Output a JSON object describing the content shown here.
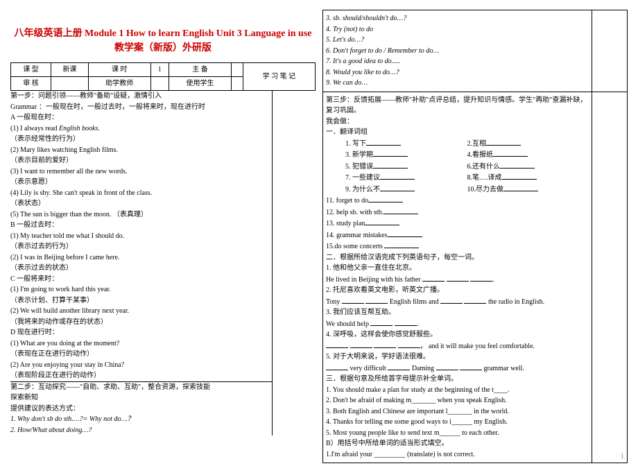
{
  "title": "八年级英语上册 Module 1 How to learn English Unit 3 Language in use 教学案（新版）外研版",
  "hdr": {
    "r1c1": "课  型",
    "r1c2": "新课",
    "r1c3": "课  时",
    "r1c4": "1",
    "r1c5": "主  备",
    "r2c1": "审  核",
    "r2c3": "助学教师",
    "r2c5": "使用学生",
    "notes": "学 习 笔 记"
  },
  "s1": "第一步：问题引领——教师\"备助\"设疑，激情引入",
  "s1a": "Grammar ：一般现在时，一般过去时，一般将来时，现在进行时",
  "s1b": "A 一般现在时：",
  "g1": "(1) I always read English books.",
  "g1t": "（表示经常性的行为）",
  "g2": "(2) Mary likes watching English films.",
  "g2t": "（表示目前的爱好）",
  "g3": "(3) I want to remember all the new words.",
  "g3t": "（表示意愿）",
  "g4": "(4) Lily is shy. She can't speak in front of  the class.",
  "g4t": "（表状态）",
  "g5": "(5) The sun is bigger than the moon.  （表真理）",
  "s1c": "B 一般过去时：",
  "p1": "(1) My teacher told me what I should do.",
  "p1t": "（表示过去的行为）",
  "p2": "(2) I was in Beijing before I came here.",
  "p2t": "（表示过去的状态）",
  "s1d": "C 一般将来时：",
  "f1": "(1) I'm going to work hard this year.",
  "f1t": "（表示计划、打算干某事）",
  "f2": "(2) We will build another library next  year.",
  "f2t": "（我将来的动作或存在的状态）",
  "s1e": "D 现在进行时：",
  "d1": "(1) What are you doing at the moment?",
  "d1t": "（表现在正在进行的动作）",
  "d2": "(2) Are you enjoying your stay in China?",
  "d2t": "（表现阶段正在进行的动作）",
  "s2": "第二步：互动探究——\"自助、求助、互助\"，整合资源，探索技能",
  "s2a": "探索新知",
  "s2b": "提供建议的表达方式：",
  "ex1": "1.  Why don't  sb do sth.…?= Why not do…？",
  "ex2": "2.  How/What about doing…?",
  "ex3": "3.  sb. should/shouldn't do…?",
  "ex4": "4.  Try (not) to do",
  "ex5": "5.  Let's do…?",
  "ex6": "6.  Don't forget to do / Remember to do…",
  "ex7": "7.  It's a good idea to do.....",
  "ex8": "8.  Would you like to do…?",
  "ex9": "9.  We can do…",
  "s3": "第三步：反馈拓展——教师\"补助\"点评总结，提升知识与情感。学生\"再助\"查漏补缺，复习巩固。",
  "s3a": "我会做：",
  "s3b": "一．翻译词组",
  "t1": "1. 写下",
  "t2": "2.互相",
  "t3": "3.  新学期",
  "t4": "4.看报纸",
  "t5": "5.  犯错误",
  "t6": "6.还有什么",
  "t7": "7.  一些建议",
  "t8": "8.笔….译成",
  "t9": "9.  为什么不",
  "t10": "10.尽力去做",
  "t11": "11. forget to do",
  "t12": "12. help sb. with sth.",
  "t13": "13. study plan",
  "t14": "14. grammar mistakes",
  "t15": "15.do some concerts ",
  "s3c": "二．根据所给汉语完成下列英语句子，每空一词。",
  "c1": "1. 他和他父亲一直住在北京。",
  "c1e": "He lived in Beijing with his father ",
  "c2": "2. 托尼喜欢看英文电影，听英文广播。",
  "c2e1": "Tony ",
  "c2e2": " English films  and ",
  "c2e3": " the radio in English.",
  "c3": "3. 我们应该互帮互助。",
  "c3e": "We should help ",
  "c4": "4. 深呼吸，这样会使你感觉舒服些。",
  "c4e": "， and it  will make you feel comfortable.",
  "c5": "5. 对于大明来说，学好语法很难。",
  "c5e1": " very difficult ",
  "c5e2": " Daming ",
  "c5e3": " grammar well.",
  "s3d": "三．根据句意及所给首字母提示补全单词。",
  "b1": "1. You should make a plan for study at the beginning of the t____.",
  "b2": "2. Don't be afraid of making m_______ when you speak English.",
  "b3": "3. Both English and Chinese are important l_______ in the world.",
  "b4": "4. Thanks for telling me some good ways to   i______ my English.",
  "b5": "5. Most young people like to send text m______ to each other.",
  "s3e": "B）用括号中所给单词的适当形式填空。",
  "b6": "1.I'm afraid your _________ (translate)  is not correct.",
  "pgnum": "1",
  "italic_word": "English books."
}
